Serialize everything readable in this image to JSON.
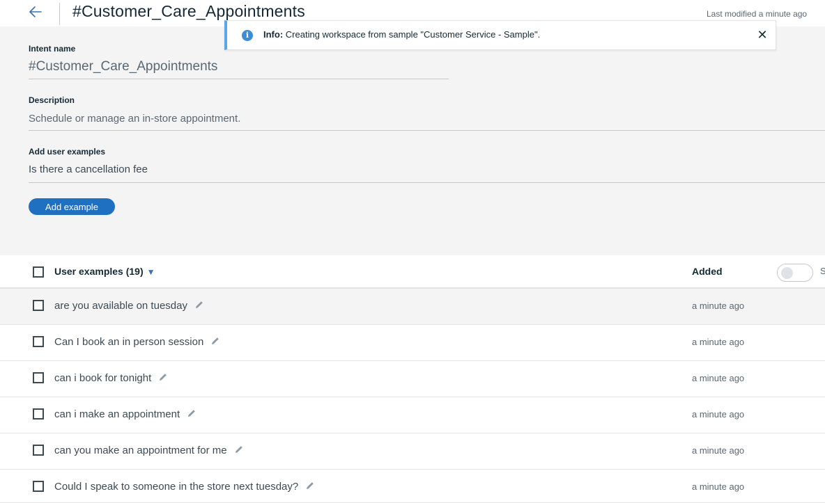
{
  "header": {
    "back_icon": "arrow-left-icon",
    "title": "#Customer_Care_Appointments",
    "last_modified": "Last modified a minute ago"
  },
  "toast": {
    "icon": "info-icon",
    "prefix": "Info:",
    "message": "Creating workspace from sample \"Customer Service - Sample\".",
    "close_icon": "close-icon"
  },
  "form": {
    "intent_label": "Intent name",
    "intent_value": "#Customer_Care_Appointments",
    "description_label": "Description",
    "description_value": "Schedule or manage an in-store appointment.",
    "examples_label": "Add user examples",
    "examples_value": "Is there a cancellation fee",
    "add_button": "Add example"
  },
  "table": {
    "header_label": "User examples (19)",
    "sort_icon": "caret-down-icon",
    "added_label": "Added",
    "toggle_on": false,
    "toggle_partial_label": "S",
    "rows": [
      {
        "text": "are you available on tuesday",
        "added": "a minute ago"
      },
      {
        "text": "Can I book an in person session",
        "added": "a minute ago"
      },
      {
        "text": "can i book for tonight",
        "added": "a minute ago"
      },
      {
        "text": "can i make an appointment",
        "added": "a minute ago"
      },
      {
        "text": "can you make an appointment for me",
        "added": "a minute ago"
      },
      {
        "text": "Could I speak to someone in the store next tuesday?",
        "added": "a minute ago"
      }
    ]
  },
  "colors": {
    "accent": "#1f70c1",
    "info": "#5aa6e8",
    "form_bg": "#f4f4f4"
  }
}
